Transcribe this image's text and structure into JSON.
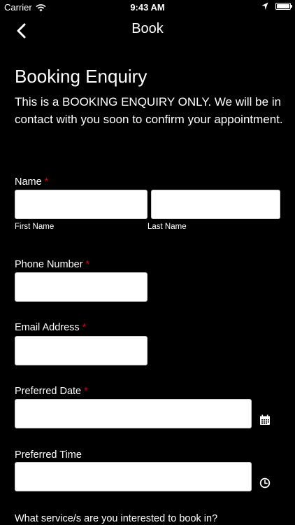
{
  "status_bar": {
    "carrier": "Carrier",
    "time": "9:43 AM"
  },
  "nav": {
    "title": "Book",
    "back_icon": "chevron-left-icon"
  },
  "page": {
    "title": "Booking Enquiry",
    "intro": "This is a BOOKING ENQUIRY ONLY. We will be in contact with you soon to confirm your appointment."
  },
  "form": {
    "required_marker": "*",
    "name": {
      "label": "Name",
      "first_sublabel": "First Name",
      "last_sublabel": "Last Name",
      "first_value": "",
      "last_value": ""
    },
    "phone": {
      "label": "Phone Number",
      "value": ""
    },
    "email": {
      "label": "Email Address",
      "value": ""
    },
    "date": {
      "label": "Preferred Date",
      "value": "",
      "icon": "calendar-icon"
    },
    "time": {
      "label": "Preferred Time",
      "value": "",
      "icon": "clock-icon"
    },
    "services_question": "What service/s are you interested to book in?"
  },
  "colors": {
    "background": "#000000",
    "text": "#ffffff",
    "required": "#d0021b",
    "input_bg": "#ffffff"
  }
}
